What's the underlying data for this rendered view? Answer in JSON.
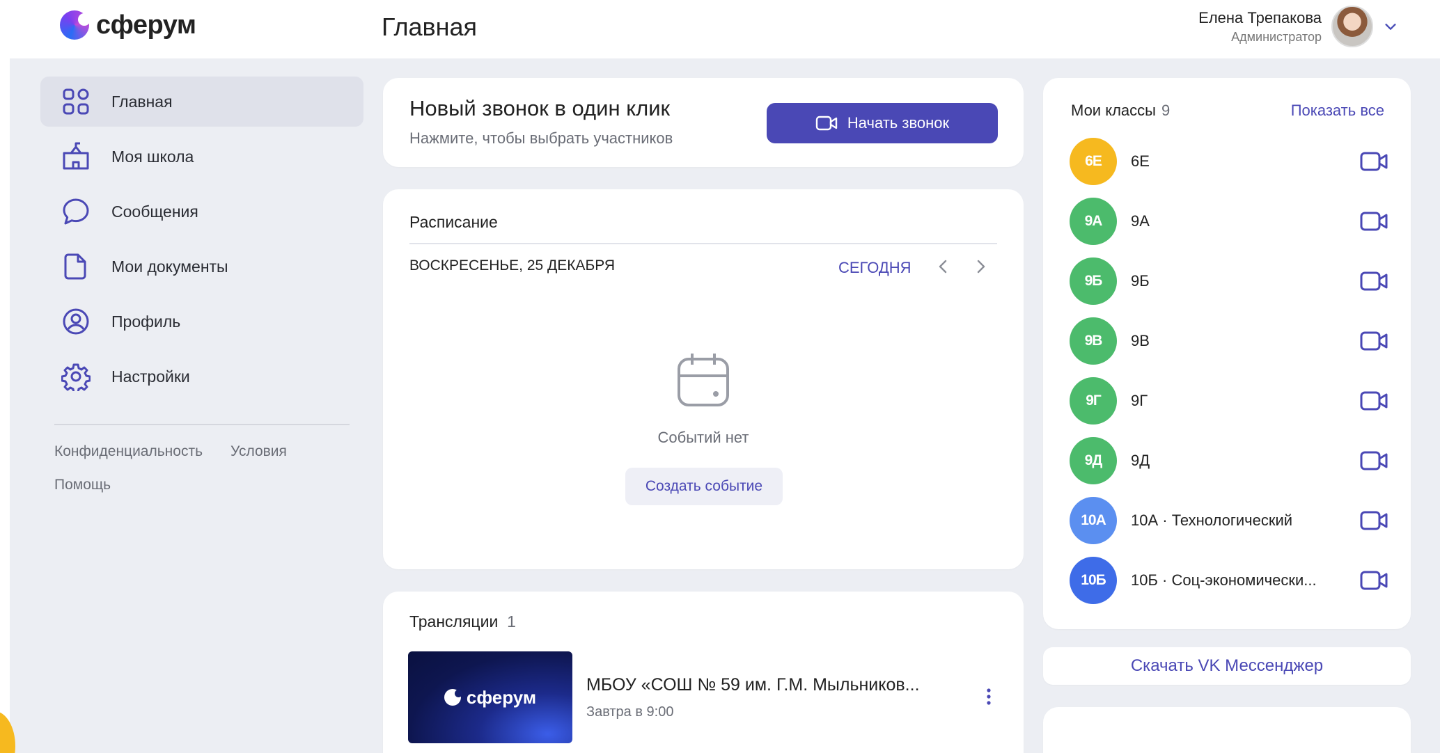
{
  "app": {
    "logo_text": "сферум",
    "page_title": "Главная"
  },
  "user": {
    "name": "Елена Трепакова",
    "role": "Администратор"
  },
  "sidebar": {
    "items": [
      {
        "label": "Главная",
        "icon": "grid-icon",
        "active": true
      },
      {
        "label": "Моя школа",
        "icon": "school-icon",
        "active": false
      },
      {
        "label": "Сообщения",
        "icon": "message-icon",
        "active": false
      },
      {
        "label": "Мои документы",
        "icon": "document-icon",
        "active": false
      },
      {
        "label": "Профиль",
        "icon": "profile-icon",
        "active": false
      },
      {
        "label": "Настройки",
        "icon": "gear-icon",
        "active": false
      }
    ],
    "links": {
      "privacy": "Конфиденциальность",
      "terms": "Условия",
      "help": "Помощь"
    }
  },
  "call": {
    "title": "Новый звонок в один клик",
    "subtitle": "Нажмите, чтобы выбрать участников",
    "button": "Начать звонок"
  },
  "schedule": {
    "title": "Расписание",
    "date": "ВОСКРЕСЕНЬЕ, 25 ДЕКАБРЯ",
    "today": "СЕГОДНЯ",
    "empty": "Событий нет",
    "create": "Создать событие"
  },
  "streams": {
    "title": "Трансляции",
    "count": "1",
    "thumb_text": "сферум",
    "item_name": "МБОУ «СОШ № 59 им. Г.М. Мыльников...",
    "item_time": "Завтра в 9:00"
  },
  "classes": {
    "title": "Мои классы",
    "count": "9",
    "show_all": "Показать все",
    "items": [
      {
        "badge": "6Е",
        "name": "6Е",
        "color": "#f6b91f"
      },
      {
        "badge": "9А",
        "name": "9А",
        "color": "#4cbb6c"
      },
      {
        "badge": "9Б",
        "name": "9Б",
        "color": "#4cbb6c"
      },
      {
        "badge": "9В",
        "name": "9В",
        "color": "#4cbb6c"
      },
      {
        "badge": "9Г",
        "name": "9Г",
        "color": "#4cbb6c"
      },
      {
        "badge": "9Д",
        "name": "9Д",
        "color": "#4cbb6c"
      },
      {
        "badge": "10А",
        "name": "10А · Технологический",
        "color": "#5b8ff0"
      },
      {
        "badge": "10Б",
        "name": "10Б · Соц-экономически...",
        "color": "#3e6ce8"
      }
    ]
  },
  "vk": {
    "label": "Скачать VK Мессенджер"
  },
  "colors": {
    "accent": "#4a48b5",
    "active_nav": "#dfe1ea",
    "background": "#eceef3"
  }
}
